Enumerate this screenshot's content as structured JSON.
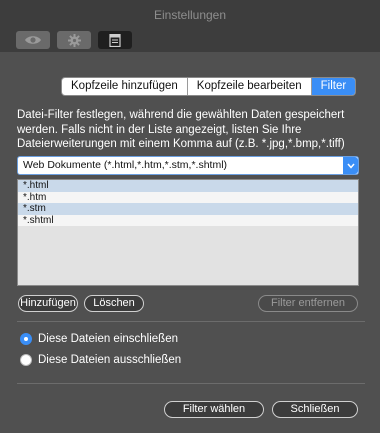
{
  "window": {
    "title": "Einstellungen"
  },
  "toolbar": {
    "buttons": [
      {
        "icon": "eye-icon",
        "active": false
      },
      {
        "icon": "gear-icon",
        "active": false
      },
      {
        "icon": "document-icon",
        "active": true
      }
    ]
  },
  "tabs": [
    {
      "label": "Kopfzeile hinzufügen",
      "selected": false
    },
    {
      "label": "Kopfzeile bearbeiten",
      "selected": false
    },
    {
      "label": "Filter",
      "selected": true
    }
  ],
  "description": "Datei-Filter festlegen, während die gewählten Daten gespeichert werden. Falls nicht in der Liste angezeigt, listen Sie Ihre Dateierweiterungen mit einem Komma auf (z.B. *.jpg,*.bmp,*.tiff)",
  "filter_select": {
    "value": "Web Dokumente (*.html,*.htm,*.stm,*.shtml)"
  },
  "extensions": [
    "*.html",
    "*.htm",
    "*.stm",
    "*.shtml"
  ],
  "buttons": {
    "add": "Hinzufügen",
    "delete": "Löschen",
    "remove_filter": "Filter entfernen",
    "choose_filter": "Filter wählen",
    "close": "Schließen"
  },
  "radios": [
    {
      "label": "Diese Dateien einschließen",
      "checked": true
    },
    {
      "label": "Diese Dateien ausschließen",
      "checked": false
    }
  ],
  "colors": {
    "accent": "#3a8ef6",
    "background": "#505050",
    "titlebar": "#3d3d3d"
  }
}
